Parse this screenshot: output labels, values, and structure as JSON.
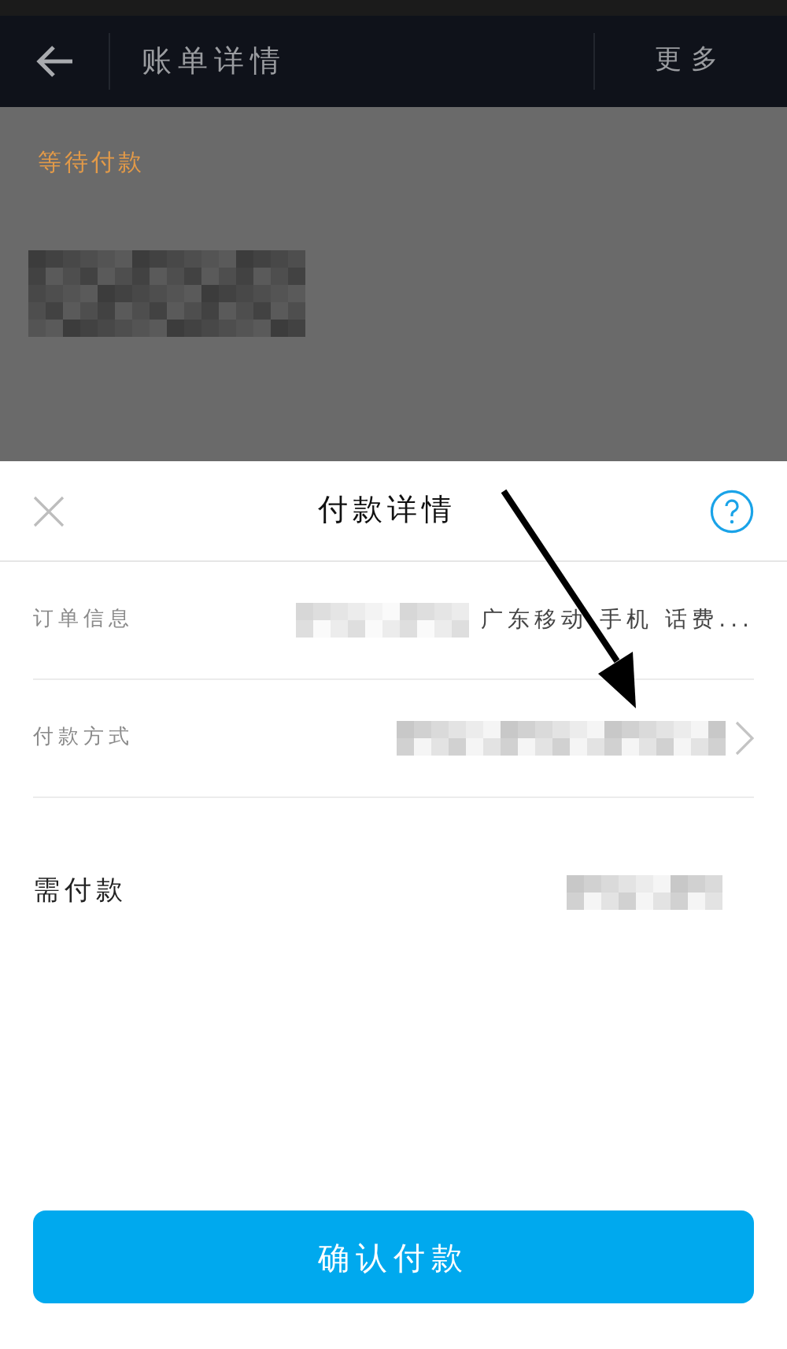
{
  "app_bar": {
    "title": "账单详情",
    "action": "更多"
  },
  "background": {
    "status": "等待付款"
  },
  "sheet": {
    "title": "付款详情",
    "rows": [
      {
        "kind": "info",
        "label": "订单信息",
        "value": "广东移动 手机 话费..."
      },
      {
        "kind": "link",
        "label": "付款方式"
      },
      {
        "kind": "total",
        "label": "需付款"
      }
    ]
  },
  "confirm_button": "确认付款"
}
